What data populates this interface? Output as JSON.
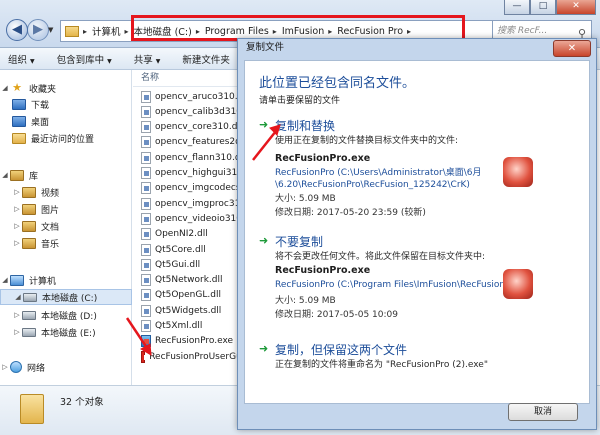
{
  "explorer": {
    "address": [
      "计算机",
      "本地磁盘 (C:)",
      "Program Files",
      "ImFusion",
      "RecFusion Pro"
    ],
    "search_placeholder": "搜索 RecF...",
    "window_controls": [
      "—",
      "□",
      "✕"
    ],
    "toolbar": [
      {
        "label": "组织",
        "dropdown": true
      },
      {
        "label": "包含到库中",
        "dropdown": true
      },
      {
        "label": "共享",
        "dropdown": true
      },
      {
        "label": "新建文件夹",
        "dropdown": false
      }
    ],
    "nav": {
      "favorites": "收藏夹",
      "favorites_items": [
        "下载",
        "桌面",
        "最近访问的位置"
      ],
      "library": "库",
      "library_items": [
        "视频",
        "图片",
        "文档",
        "音乐"
      ],
      "computer": "计算机",
      "computer_items": [
        "本地磁盘 (C:)",
        "本地磁盘 (D:)",
        "本地磁盘 (E:)"
      ],
      "network": "网络"
    },
    "column_name": "名称",
    "files": [
      "opencv_aruco310.dll",
      "opencv_calib3d310.dll",
      "opencv_core310.dll",
      "opencv_features2d310.dll",
      "opencv_flann310.dll",
      "opencv_highgui310.dll",
      "opencv_imgcodecs310.dll",
      "opencv_imgproc310.dll",
      "opencv_videoio310.dll",
      "OpenNI2.dll",
      "Qt5Core.dll",
      "Qt5Gui.dll",
      "Qt5Network.dll",
      "Qt5OpenGL.dll",
      "Qt5Widgets.dll",
      "Qt5Xml.dll",
      "RecFusionPro.exe",
      "RecFusionProUserGuide.pdf"
    ],
    "status": "32 个对象"
  },
  "dialog": {
    "title": "复制文件",
    "close": "✕",
    "heading": "此位置已经包含同名文件。",
    "subheading": "请单击要保留的文件",
    "option_replace": {
      "title": "复制和替换",
      "desc": "使用正在复制的文件替换目标文件夹中的文件:",
      "file": "RecFusionPro.exe",
      "path": "RecFusionPro (C:\\Users\\Administrator\\桌面\\6月\\6.20\\RecFusionPro\\RecFusion_125242\\CrK)",
      "size": "大小: 5.09 MB",
      "modified": "修改日期: 2017-05-20 23:59 (较新)"
    },
    "option_skip": {
      "title": "不要复制",
      "desc": "将不会更改任何文件。将此文件保留在目标文件夹中:",
      "file": "RecFusionPro.exe",
      "path": "RecFusionPro (C:\\Program Files\\ImFusion\\RecFusion Pro)",
      "size": "大小: 5.09 MB",
      "modified": "修改日期: 2017-05-05 10:09"
    },
    "option_keep": {
      "title": "复制，但保留这两个文件",
      "desc": "正在复制的文件将重命名为 \"RecFusionPro (2).exe\""
    },
    "cancel": "取消"
  },
  "colors": {
    "accent": "#1d4e9a",
    "highlight": "#e5161d",
    "arrow": "#1f9a3a"
  }
}
